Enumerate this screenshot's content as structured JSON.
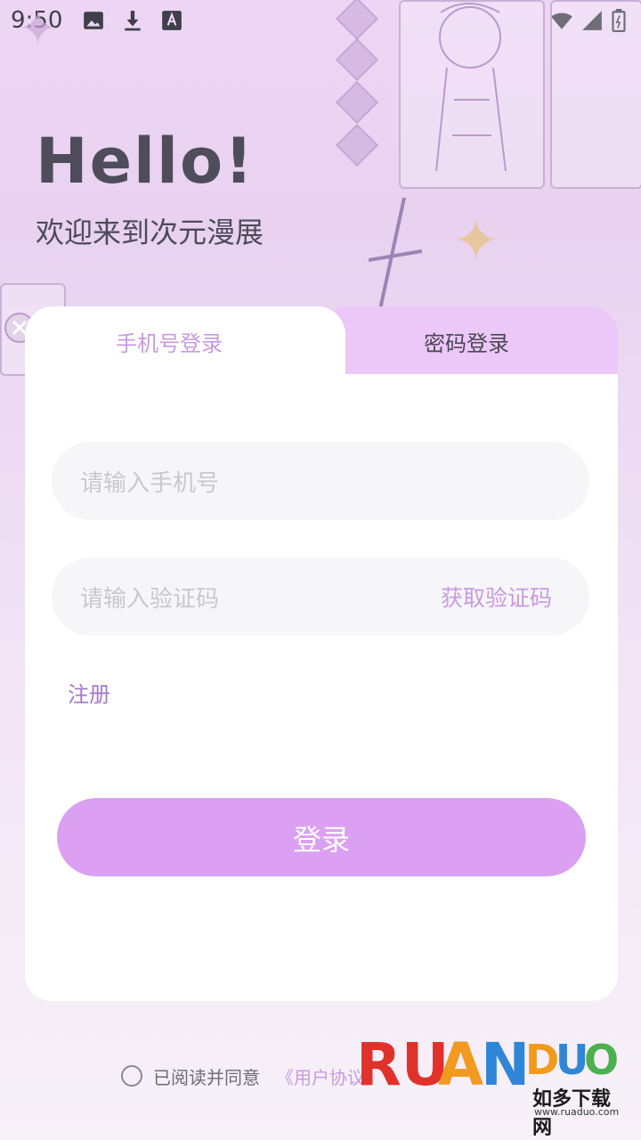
{
  "status_bar": {
    "time": "9:50"
  },
  "hero": {
    "title": "Hello!",
    "subtitle": "欢迎来到次元漫展"
  },
  "tabs": {
    "phone_login": "手机号登录",
    "password_login": "密码登录"
  },
  "form": {
    "phone_placeholder": "请输入手机号",
    "code_placeholder": "请输入验证码",
    "get_code": "获取验证码",
    "register": "注册",
    "login": "登录"
  },
  "agreement": {
    "text": "已阅读并同意",
    "link": "《用户协议"
  },
  "watermark": {
    "logo": "RUANDUO",
    "cn": "如多下载网",
    "url": "www.ruaduo.com"
  },
  "colors": {
    "accent": "#dba0f2",
    "accent_text": "#c99ae0",
    "tab_inactive_bg": "#ebc8f7"
  }
}
